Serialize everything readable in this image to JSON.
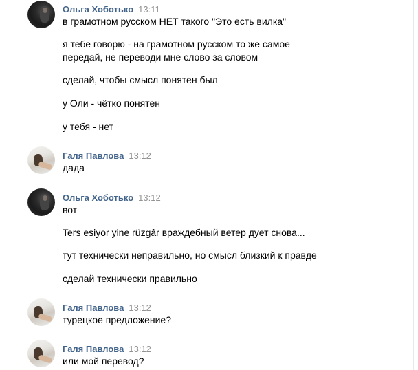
{
  "messages": [
    {
      "author": "Ольга Хоботько",
      "time": "13:11",
      "avatar": "olga-avatar",
      "lines": [
        "в грамотном русском НЕТ такого \"Это есть вилка\"",
        "я тебе говорю - на грамотном русском то же самое",
        "передай, не переводи мне слово за словом",
        "сделай, чтобы смысл понятен был",
        "у Оли - чётко понятен",
        "у тебя - нет"
      ]
    },
    {
      "author": "Галя Павлова",
      "time": "13:12",
      "avatar": "galya-avatar",
      "lines": [
        "дада"
      ]
    },
    {
      "author": "Ольга Хоботько",
      "time": "13:12",
      "avatar": "olga-avatar",
      "lines": [
        "вот",
        "Ters esiyor yine rüzgâr враждебный ветер дует снова...",
        "тут технически неправильно, но смысл близкий к правде",
        "сделай технически правильно"
      ]
    },
    {
      "author": "Галя Павлова",
      "time": "13:12",
      "avatar": "galya-avatar",
      "lines": [
        "турецкое предложение?"
      ]
    },
    {
      "author": "Галя Павлова",
      "time": "13:12",
      "avatar": "galya-avatar",
      "lines": [
        "или мой перевод?"
      ]
    }
  ],
  "colors": {
    "author": "#42648b",
    "time": "#939393",
    "text": "#000000"
  }
}
